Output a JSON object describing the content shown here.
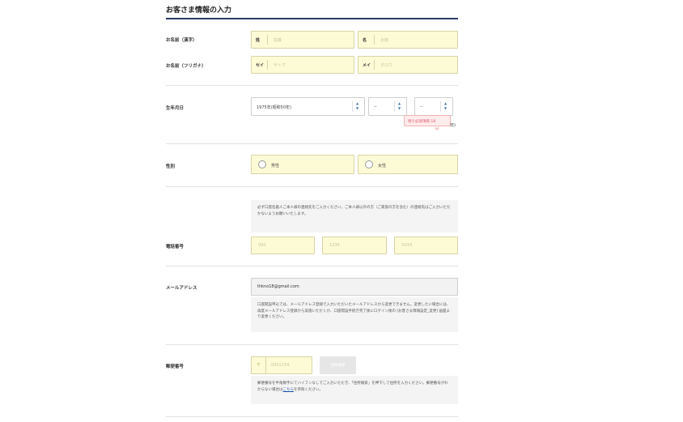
{
  "section": {
    "title": "お客さま情報の入力"
  },
  "name_kanji": {
    "label": "お名前（漢字）",
    "last_tag": "姓",
    "last_placeholder": "佐藤",
    "first_tag": "名",
    "first_placeholder": "太郎"
  },
  "name_kana": {
    "label": "お名前（フリガナ）",
    "last_tag": "セイ",
    "last_placeholder": "サトウ",
    "first_tag": "メイ",
    "first_placeholder": "タロウ"
  },
  "birthday": {
    "label": "生年月日",
    "year_value": "1975年(昭和50年)",
    "month_value": "--",
    "day_value": "--",
    "tooltip": "残り必須項目 18",
    "tooltip_tail": "日)"
  },
  "gender": {
    "label": "性別",
    "male": "男性",
    "female": "女性"
  },
  "phone": {
    "label": "電話番号",
    "note": "必ず口座名義人ご本人様の連絡先をご入力ください。ご本人様以外の方（ご家族の方を含む）の連絡先はご入力いただかないようお願いいたします。",
    "ph1": "090",
    "ph2": "1234",
    "ph3": "XXXX"
  },
  "email": {
    "label": "メールアドレス",
    "value": "thkno18@gmail.com",
    "note": "口座開設申込では、メールアドレス登録で入力いただいたメールアドレスから変更できません。変更したい場合には、再度メールアドレス登録から実施いただくか、口座開設手続き完了後にログイン後の [お客さま情報設定_変更] 画面より変更ください。"
  },
  "postal": {
    "label": "郵便番号",
    "mark": "〒",
    "placeholder": "0001234",
    "search_button": "住所検索",
    "note_pre": "郵便番号を半角数字にてハイフンなしでご入力いただき、「住所検索」を押下して住所を入力ください。郵便番号がわからない場合は",
    "note_link": "こちら",
    "note_post": "を参照ください。"
  }
}
